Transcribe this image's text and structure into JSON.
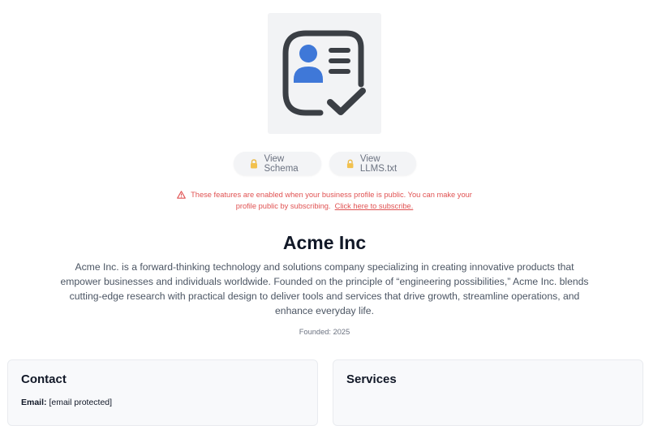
{
  "logo": {
    "icon": "contact-card-check-icon",
    "colors": {
      "outline": "#3b3f45",
      "person": "#3f78d8"
    }
  },
  "buttons": [
    {
      "label": "View Schema",
      "icon": "lock-icon"
    },
    {
      "label": "View LLMS.txt",
      "icon": "lock-icon"
    }
  ],
  "notice": {
    "line1": "These features are enabled when your business profile is public. You can make your",
    "line2": "profile public by subscribing.",
    "link": "Click here to subscribe.",
    "icon": "warning-triangle-icon",
    "color": "#e05252"
  },
  "company": {
    "name": "Acme Inc",
    "description": "Acme Inc. is a forward-thinking technology and solutions company specializing in creating innovative products that empower businesses and individuals worldwide. Founded on the principle of “engineering possibilities,” Acme Inc. blends cutting-edge research with practical design to deliver tools and services that drive growth, streamline operations, and enhance everyday life.",
    "founded": "Founded: 2025"
  },
  "contact": {
    "title": "Contact",
    "email_label": "Email:",
    "email_value": "[email protected]"
  },
  "services": {
    "title": "Services"
  }
}
